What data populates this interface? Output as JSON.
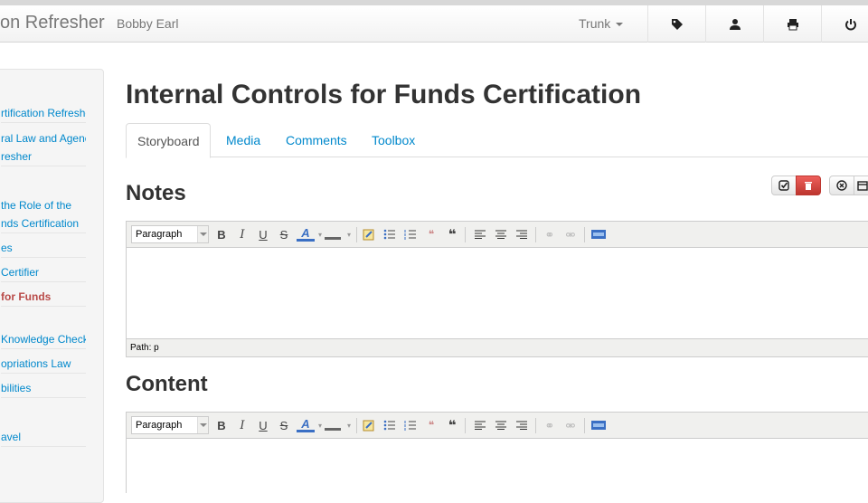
{
  "header": {
    "brand": "on Refresher",
    "user": "Bobby Earl",
    "branch": "Trunk",
    "icons": [
      "tag-icon",
      "user-icon",
      "print-icon",
      "power-icon"
    ]
  },
  "sidebar": {
    "items": [
      {
        "label": "rtification Refresher",
        "active": false
      },
      {
        "label": "ral Law and Agency",
        "active": false
      },
      {
        "label": "resher",
        "active": false
      },
      {
        "label": "the Role of the",
        "active": false
      },
      {
        "label": "nds Certification",
        "active": false
      },
      {
        "label": "es",
        "active": false
      },
      {
        "label": " Certifier",
        "active": false
      },
      {
        "label": "for Funds",
        "active": true
      },
      {
        "label": "Knowledge Check",
        "active": false
      },
      {
        "label": "opriations Law",
        "active": false
      },
      {
        "label": "bilities",
        "active": false
      },
      {
        "label": "avel",
        "active": false
      }
    ]
  },
  "page": {
    "title": "Internal Controls for Funds Certification"
  },
  "tabs": [
    {
      "label": "Storyboard",
      "active": true
    },
    {
      "label": "Media",
      "active": false
    },
    {
      "label": "Comments",
      "active": false
    },
    {
      "label": "Toolbox",
      "active": false
    }
  ],
  "notes": {
    "heading": "Notes",
    "format": "Paragraph",
    "path": "Path: p"
  },
  "content": {
    "heading": "Content",
    "format": "Paragraph"
  },
  "colors": {
    "link": "#0088cc",
    "active_side": "#b94a48",
    "danger": "#da4f49"
  }
}
